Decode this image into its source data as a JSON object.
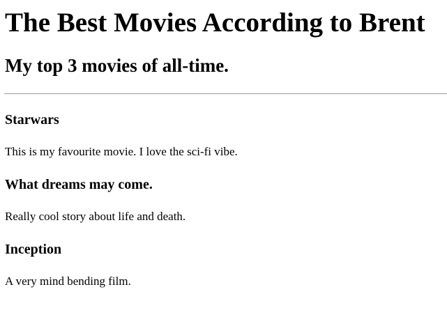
{
  "header": {
    "title": "The Best Movies According to Brent",
    "subtitle": "My top 3 movies of all-time."
  },
  "movies": [
    {
      "title": "Starwars",
      "description": "This is my favourite movie. I love the sci-fi vibe."
    },
    {
      "title": "What dreams may come.",
      "description": "Really cool story about life and death."
    },
    {
      "title": "Inception",
      "description": "A very mind bending film."
    }
  ]
}
